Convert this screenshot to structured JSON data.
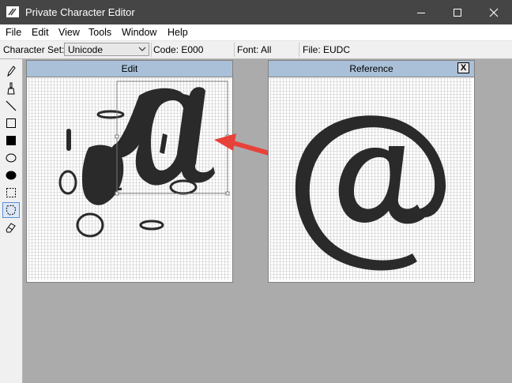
{
  "window": {
    "title": "Private Character Editor"
  },
  "menu": [
    "File",
    "Edit",
    "View",
    "Tools",
    "Window",
    "Help"
  ],
  "infobar": {
    "charset_label": "Character Set:",
    "charset_value": "Unicode",
    "code": "Code: E000",
    "font": "Font: All",
    "file": "File: EUDC"
  },
  "tools": [
    "pencil-icon",
    "brush-icon",
    "line-icon",
    "hollow-rectangle-icon",
    "filled-rectangle-icon",
    "hollow-ellipse-icon",
    "filled-ellipse-icon",
    "rectangular-selection-icon",
    "freeform-selection-icon",
    "eraser-icon"
  ],
  "edit_panel": {
    "title": "Edit"
  },
  "reference_panel": {
    "title": "Reference",
    "close_label": "X"
  },
  "colors": {
    "titlebar": "#454545",
    "panel_header": "#a9c0d8",
    "grid_line": "#b0b0b0",
    "ink": "#2a2a2a",
    "arrow": "#e8413a",
    "workspace": "#ababab"
  }
}
